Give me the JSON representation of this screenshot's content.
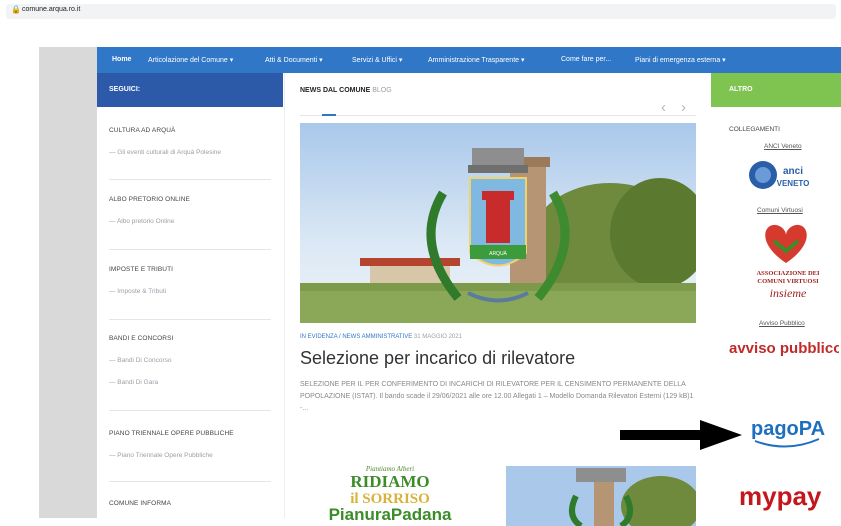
{
  "browser": {
    "url": "comune.arqua.ro.it"
  },
  "nav": {
    "items": [
      "Home",
      "Articolazione del Comune ▾",
      "Atti & Documenti ▾",
      "Servizi & Uffici ▾",
      "Amministrazione Trasparente ▾",
      "Come fare per...",
      "Piani di emergenza esterna ▾"
    ]
  },
  "left": {
    "header": "SEGUICI:",
    "sections": [
      {
        "title": "CULTURA AD ARQUÀ",
        "links": [
          "— Gli eventi culturali di Arquà Polesine"
        ]
      },
      {
        "title": "ALBO PRETORIO ONLINE",
        "links": [
          "— Albo pretorio Online"
        ]
      },
      {
        "title": "IMPOSTE E TRIBUTI",
        "links": [
          "— Imposte & Tributi"
        ]
      },
      {
        "title": "BANDI E CONCORSI",
        "links": [
          "— Bandi Di Concorso",
          "— Bandi Di Gara"
        ]
      },
      {
        "title": "PIANO TRIENNALE OPERE PUBBLICHE",
        "links": [
          "— Piano Triennale Opere Pubbliche"
        ]
      },
      {
        "title": "COMUNE INFORMA",
        "links": []
      }
    ]
  },
  "main": {
    "title": "NEWS DAL COMUNE",
    "title_suffix": "BLOG",
    "prev": "‹",
    "next": "›",
    "category": "IN EVIDENZA / NEWS AMMINISTRATIVE",
    "date": "31 MAGGIO 2021",
    "headline": "Selezione per incarico di rilevatore",
    "excerpt": "SELEZIONE PER IL PER CONFERIMENTO DI INCARICHI DI RILEVATORE PER IL CENSIMENTO PERMANENTE DELLA POPOLAZIONE (ISTAT). Il bando scade il 29/06/2021 alle ore 12.00 Allegati 1 – Modello Domanda Rilevatori Esterni (129 kB)1 -...",
    "crest_text": "ARQUÀ",
    "thumb_lines": [
      "Piantiamo Alberi",
      "RIDIAMO",
      "il SORRISO",
      "PianuraPadana"
    ]
  },
  "right": {
    "header": "ALTRO",
    "section_title": "COLLEGAMENTI",
    "links": [
      "ANCI Veneto",
      "Comuni Virtuosi",
      "Avviso Pubblico"
    ],
    "logos": {
      "anci": "anci VENETO",
      "virtuosi_1": "ASSOCIAZIONE DEI",
      "virtuosi_2": "COMUNI VIRTUOSI",
      "virtuosi_3": "insieme",
      "avviso": "avviso pubblico",
      "pagopa": "pagoPA",
      "mypay": "mypay"
    }
  },
  "colors": {
    "nav": "#3177c7",
    "left_header": "#2d5aa8",
    "right_header": "#7fc350"
  }
}
